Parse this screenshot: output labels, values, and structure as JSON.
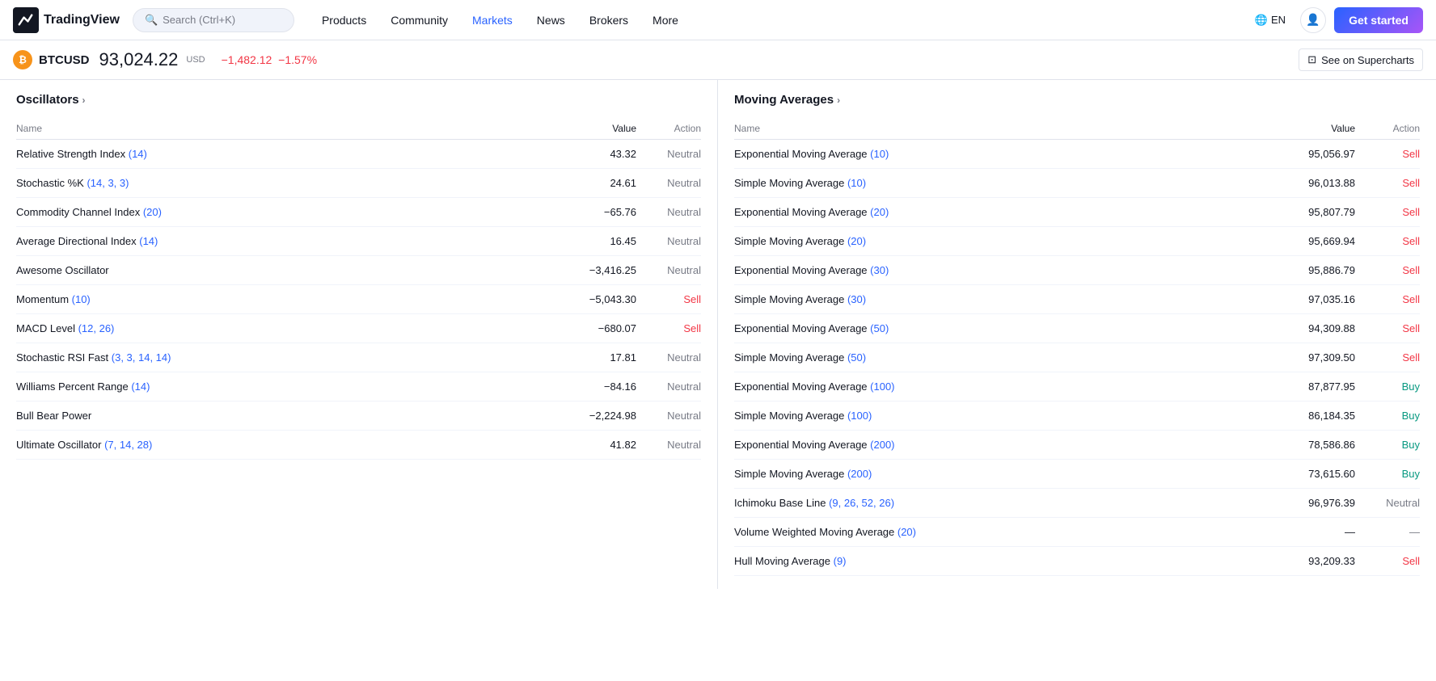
{
  "nav": {
    "logo_text": "TradingView",
    "search_placeholder": "Search (Ctrl+K)",
    "links": [
      {
        "label": "Products",
        "active": false
      },
      {
        "label": "Community",
        "active": false
      },
      {
        "label": "Markets",
        "active": true
      },
      {
        "label": "News",
        "active": false
      },
      {
        "label": "Brokers",
        "active": false
      },
      {
        "label": "More",
        "active": false
      }
    ],
    "lang": "EN",
    "get_started": "Get started"
  },
  "ticker": {
    "symbol": "BTCUSD",
    "price": "93,024.22",
    "currency": "USD",
    "change": "−1,482.12",
    "change_pct": "−1.57%",
    "see_supercharts": "See on Supercharts"
  },
  "oscillators": {
    "title": "Oscillators",
    "col_name": "Name",
    "col_value": "Value",
    "col_action": "Action",
    "rows": [
      {
        "name": "Relative Strength Index",
        "param": "(14)",
        "value": "43.32",
        "action": "Neutral",
        "action_type": "neutral"
      },
      {
        "name": "Stochastic %K",
        "param": "(14, 3, 3)",
        "value": "24.61",
        "action": "Neutral",
        "action_type": "neutral"
      },
      {
        "name": "Commodity Channel Index",
        "param": "(20)",
        "value": "−65.76",
        "action": "Neutral",
        "action_type": "neutral"
      },
      {
        "name": "Average Directional Index",
        "param": "(14)",
        "value": "16.45",
        "action": "Neutral",
        "action_type": "neutral"
      },
      {
        "name": "Awesome Oscillator",
        "param": "",
        "value": "−3,416.25",
        "action": "Neutral",
        "action_type": "neutral"
      },
      {
        "name": "Momentum",
        "param": "(10)",
        "value": "−5,043.30",
        "action": "Sell",
        "action_type": "sell"
      },
      {
        "name": "MACD Level",
        "param": "(12, 26)",
        "value": "−680.07",
        "action": "Sell",
        "action_type": "sell"
      },
      {
        "name": "Stochastic RSI Fast",
        "param": "(3, 3, 14, 14)",
        "value": "17.81",
        "action": "Neutral",
        "action_type": "neutral"
      },
      {
        "name": "Williams Percent Range",
        "param": "(14)",
        "value": "−84.16",
        "action": "Neutral",
        "action_type": "neutral"
      },
      {
        "name": "Bull Bear Power",
        "param": "",
        "value": "−2,224.98",
        "action": "Neutral",
        "action_type": "neutral"
      },
      {
        "name": "Ultimate Oscillator",
        "param": "(7, 14, 28)",
        "value": "41.82",
        "action": "Neutral",
        "action_type": "neutral"
      }
    ]
  },
  "moving_averages": {
    "title": "Moving Averages",
    "col_name": "Name",
    "col_value": "Value",
    "col_action": "Action",
    "rows": [
      {
        "name": "Exponential Moving Average",
        "param": "(10)",
        "value": "95,056.97",
        "action": "Sell",
        "action_type": "sell"
      },
      {
        "name": "Simple Moving Average",
        "param": "(10)",
        "value": "96,013.88",
        "action": "Sell",
        "action_type": "sell"
      },
      {
        "name": "Exponential Moving Average",
        "param": "(20)",
        "value": "95,807.79",
        "action": "Sell",
        "action_type": "sell"
      },
      {
        "name": "Simple Moving Average",
        "param": "(20)",
        "value": "95,669.94",
        "action": "Sell",
        "action_type": "sell"
      },
      {
        "name": "Exponential Moving Average",
        "param": "(30)",
        "value": "95,886.79",
        "action": "Sell",
        "action_type": "sell"
      },
      {
        "name": "Simple Moving Average",
        "param": "(30)",
        "value": "97,035.16",
        "action": "Sell",
        "action_type": "sell"
      },
      {
        "name": "Exponential Moving Average",
        "param": "(50)",
        "value": "94,309.88",
        "action": "Sell",
        "action_type": "sell"
      },
      {
        "name": "Simple Moving Average",
        "param": "(50)",
        "value": "97,309.50",
        "action": "Sell",
        "action_type": "sell"
      },
      {
        "name": "Exponential Moving Average",
        "param": "(100)",
        "value": "87,877.95",
        "action": "Buy",
        "action_type": "buy"
      },
      {
        "name": "Simple Moving Average",
        "param": "(100)",
        "value": "86,184.35",
        "action": "Buy",
        "action_type": "buy"
      },
      {
        "name": "Exponential Moving Average",
        "param": "(200)",
        "value": "78,586.86",
        "action": "Buy",
        "action_type": "buy"
      },
      {
        "name": "Simple Moving Average",
        "param": "(200)",
        "value": "73,615.60",
        "action": "Buy",
        "action_type": "buy"
      },
      {
        "name": "Ichimoku Base Line",
        "param": "(9, 26, 52, 26)",
        "value": "96,976.39",
        "action": "Neutral",
        "action_type": "neutral"
      },
      {
        "name": "Volume Weighted Moving Average",
        "param": "(20)",
        "value": "—",
        "action": "—",
        "action_type": "dash"
      },
      {
        "name": "Hull Moving Average",
        "param": "(9)",
        "value": "93,209.33",
        "action": "Sell",
        "action_type": "sell"
      }
    ]
  }
}
